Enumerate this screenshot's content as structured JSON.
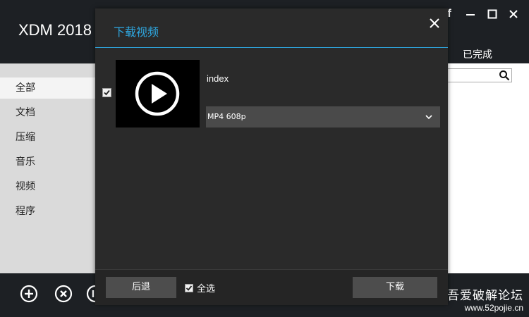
{
  "app": {
    "title": "XDM 2018",
    "window_controls": {
      "facebook_label": "f"
    },
    "tab_completed": "已完成"
  },
  "sidebar": {
    "items": [
      {
        "label": "全部",
        "active": true
      },
      {
        "label": "文档",
        "active": false
      },
      {
        "label": "压缩",
        "active": false
      },
      {
        "label": "音乐",
        "active": false
      },
      {
        "label": "视频",
        "active": false
      },
      {
        "label": "程序",
        "active": false
      }
    ]
  },
  "dialog": {
    "title": "下载视频",
    "item": {
      "checked": true,
      "name": "index",
      "format": "MP4 608p"
    },
    "footer": {
      "back_label": "后退",
      "select_all_label": "全选",
      "select_all_checked": true,
      "download_label": "下载"
    }
  },
  "watermark": {
    "title": "吾爱破解论坛",
    "url": "www.52pojie.cn"
  },
  "colors": {
    "accent": "#2ea7e0",
    "dialog_bg": "#2a2a2a",
    "app_bg": "#1d2024"
  }
}
